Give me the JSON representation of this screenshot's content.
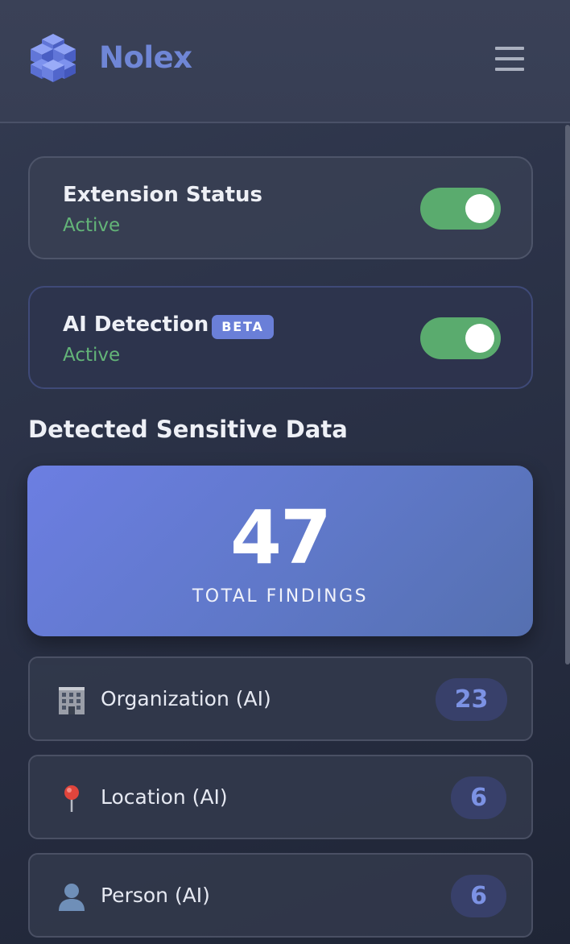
{
  "header": {
    "brand": "Nolex",
    "logo_icon": "cube-cluster-icon",
    "menu_icon": "hamburger-menu-icon"
  },
  "extension_status": {
    "title": "Extension Status",
    "status": "Active",
    "enabled": true
  },
  "ai_detection": {
    "title": "AI Detection",
    "badge": "BETA",
    "status": "Active",
    "enabled": true
  },
  "findings": {
    "section_title": "Detected Sensitive Data",
    "total": "47",
    "total_label": "TOTAL FINDINGS",
    "items": [
      {
        "icon": "office-building-icon",
        "label": "Organization (AI)",
        "count": "23"
      },
      {
        "icon": "location-pin-icon",
        "label": "Location (AI)",
        "count": "6"
      },
      {
        "icon": "person-silhouette-icon",
        "label": "Person (AI)",
        "count": "6"
      }
    ]
  },
  "colors": {
    "accent": "#6f86d6",
    "active_green": "#5aab6e",
    "status_text": "#63b478",
    "badge_bg": "#6a7fd8",
    "count_text": "#7c92e4"
  }
}
